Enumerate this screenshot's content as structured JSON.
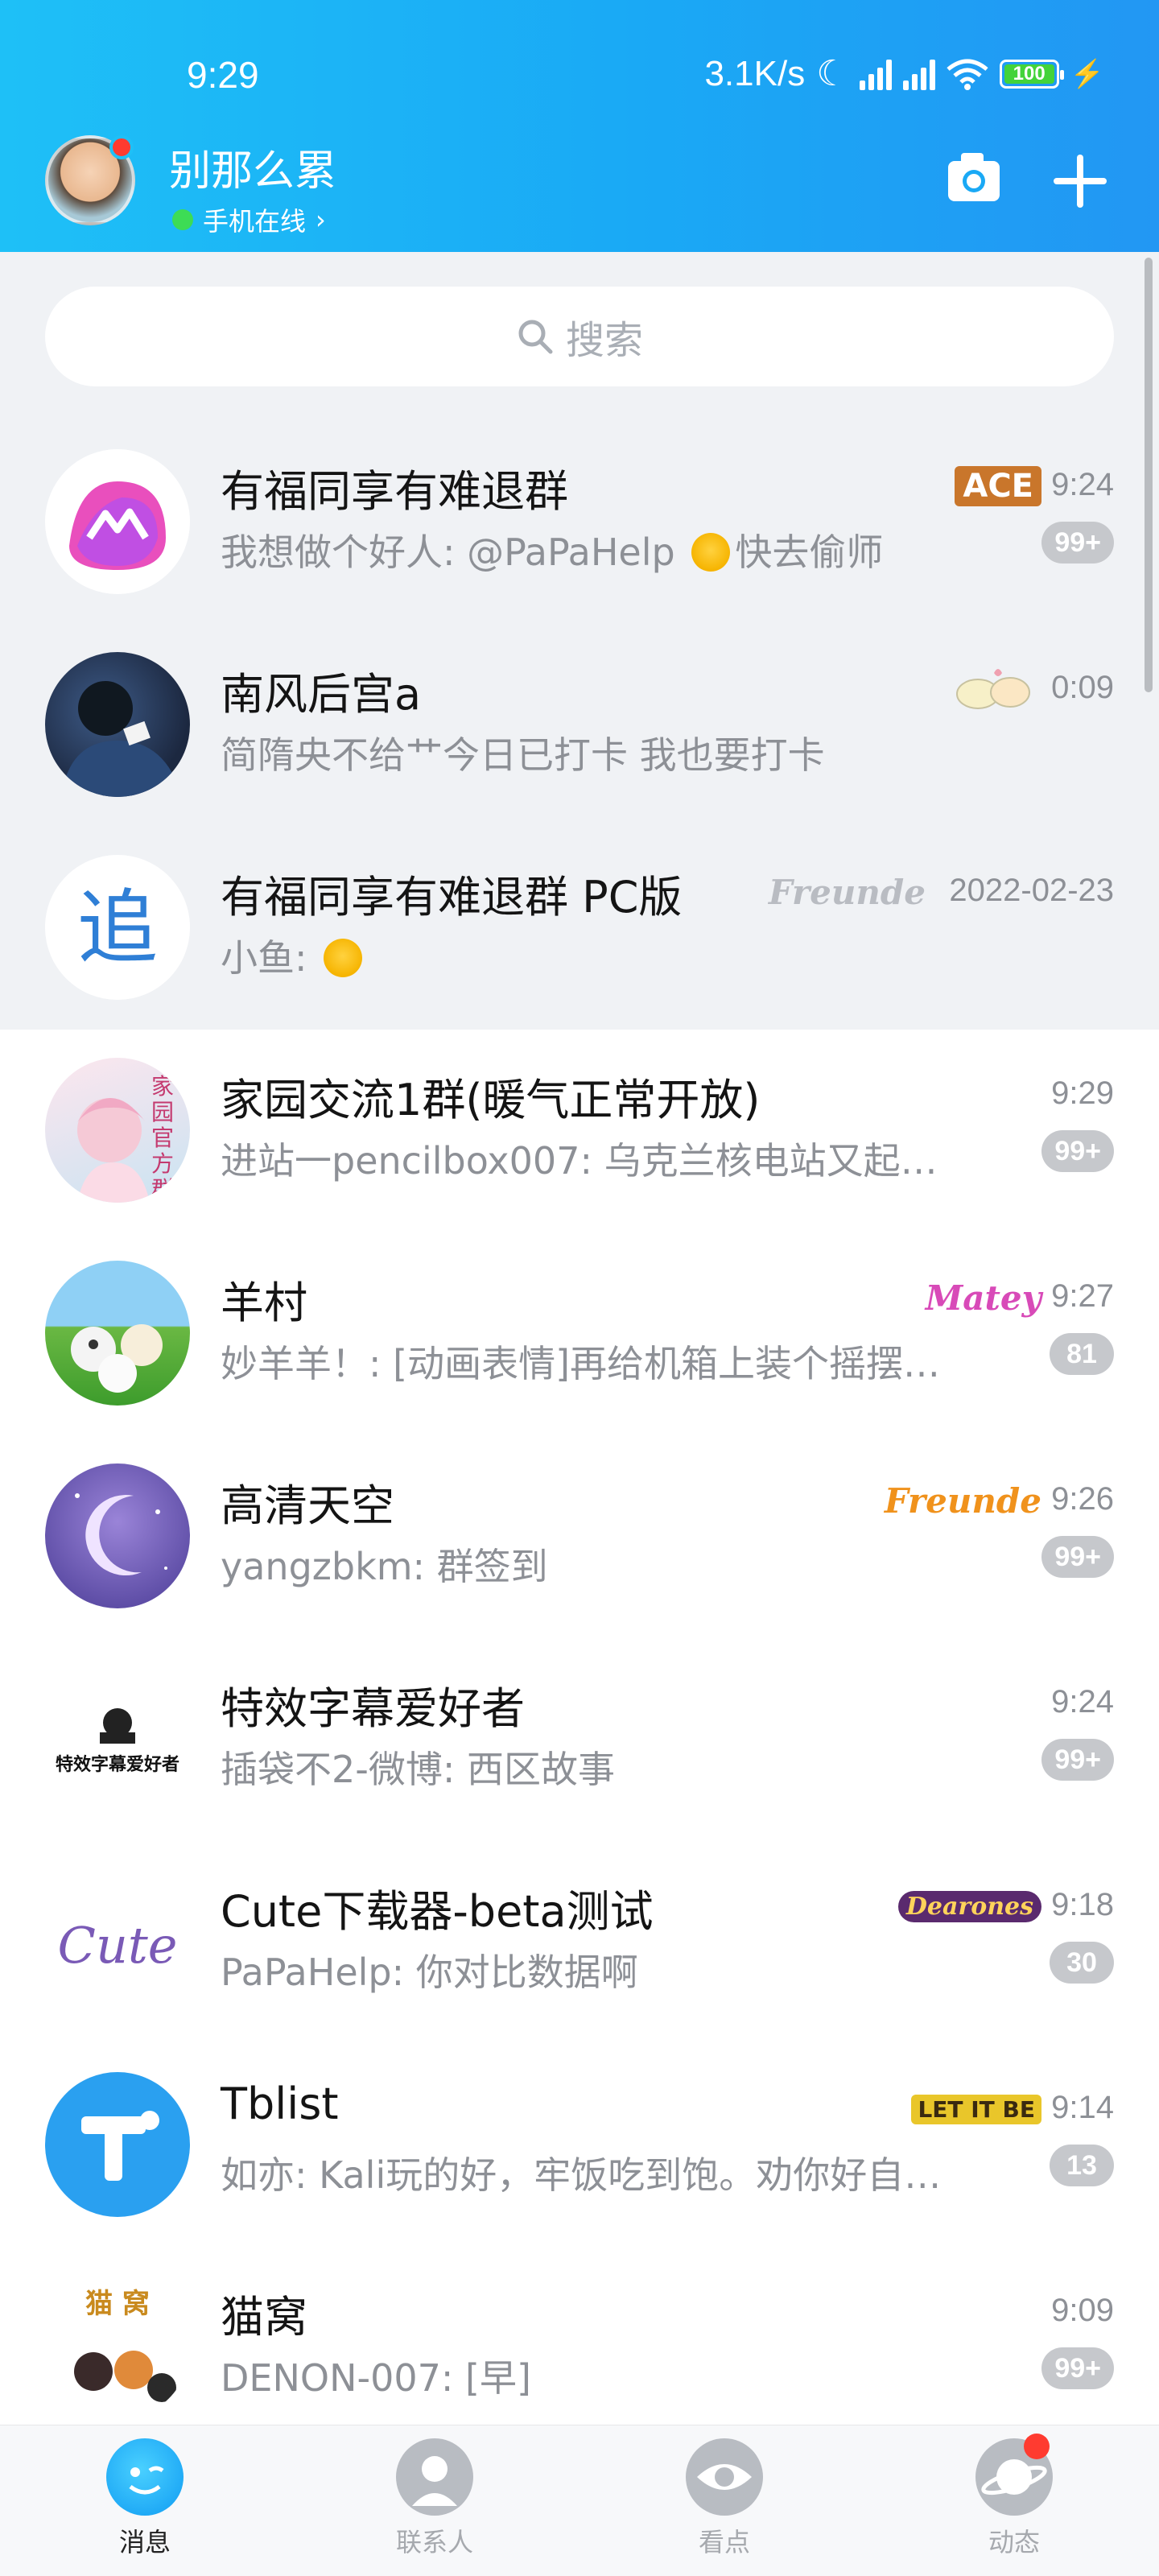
{
  "status_bar": {
    "time": "9:29",
    "net_speed": "3.1K/s",
    "battery": "100"
  },
  "header": {
    "profile_name": "别那么累",
    "online_status": "手机在线",
    "camera_icon": "camera-icon",
    "plus_icon": "plus-icon"
  },
  "search": {
    "placeholder": "搜索"
  },
  "chats": [
    {
      "title": "有福同享有难退群",
      "preview_prefix": "我想做个好人: @PaPaHelp ",
      "preview_suffix": "快去偷师",
      "time": "9:24",
      "badge": "99+",
      "tag": "ACE",
      "pinned": true
    },
    {
      "title": "南风后宫a",
      "preview": "简隋央不给艹今日已打卡   我也要打卡",
      "time": "0:09",
      "badge": "",
      "tag": "",
      "pinned": true
    },
    {
      "title": "有福同享有难退群 PC版",
      "preview_prefix": "小鱼: ",
      "preview_suffix": "",
      "time": "2022-02-23",
      "badge": "",
      "tag": "Freunde",
      "pinned": true
    },
    {
      "title": "家园交流1群(暖气正常开放)",
      "preview": "进站一pencilbox007: 乌克兰核电站又起…",
      "time": "9:29",
      "badge": "99+",
      "tag": "",
      "pinned": false
    },
    {
      "title": "羊村",
      "preview": "妙羊羊！: [动画表情]再给机箱上装个摇摆…",
      "time": "9:27",
      "badge": "81",
      "tag": "Matey",
      "pinned": false
    },
    {
      "title": "高清天空",
      "preview": "yangzbkm: 群签到",
      "time": "9:26",
      "badge": "99+",
      "tag": "Freunde",
      "pinned": false
    },
    {
      "title": "特效字幕爱好者",
      "preview": "插袋不2-微博: 西区故事",
      "time": "9:24",
      "badge": "99+",
      "tag": "",
      "pinned": false
    },
    {
      "title": "Cute下载器-beta测试",
      "preview": "PaPaHelp: 你对比数据啊",
      "time": "9:18",
      "badge": "30",
      "tag": "Dearones",
      "pinned": false
    },
    {
      "title": "Tblist",
      "preview": "如亦: Kali玩的好，牢饭吃到饱。劝你好自…",
      "time": "9:14",
      "badge": "13",
      "tag": "LET IT BE",
      "pinned": false
    },
    {
      "title": "猫窝",
      "preview": "DENON-007: [早]",
      "time": "9:09",
      "badge": "99+",
      "tag": "",
      "pinned": false
    }
  ],
  "avatar_text": {
    "chat_5_logo": "家园官方群",
    "chat_7_logo": "特效字幕爱好者",
    "chat_8_logo": "Cute",
    "chat_10_logo": "猫 窝"
  },
  "bottom_nav": {
    "messages": "消息",
    "contacts": "联系人",
    "highlights": "看点",
    "feed": "动态"
  },
  "colors": {
    "header_gradient_start": "#1ec0f7",
    "header_gradient_end": "#2297f3",
    "badge_bg": "#c6c8cc",
    "pinned_bg": "#f0f2f5",
    "notification_red": "#ff3b30",
    "online_green": "#3ddc55"
  }
}
